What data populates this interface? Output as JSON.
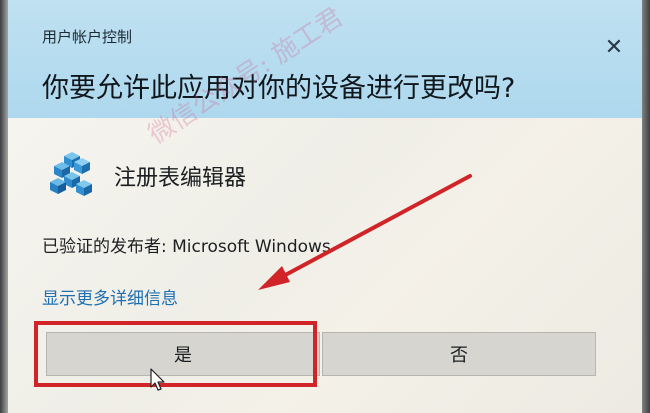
{
  "dialog": {
    "window_title": "用户帐户控制",
    "question": "你要允许此应用对你的设备进行更改吗?",
    "app_name": "注册表编辑器",
    "publisher_line": "已验证的发布者: Microsoft Windows",
    "details_link": "显示更多详细信息",
    "yes_button": "是",
    "no_button": "否",
    "close_glyph": "✕"
  },
  "overlay": {
    "watermark": "微信公众号: 施工君"
  },
  "colors": {
    "header_bg": "#aed8ee",
    "body_bg": "#f2f1ec",
    "link": "#1f6fb2",
    "annotation_red": "#d12428"
  },
  "icons": {
    "app_icon": "registry-editor-cubes-icon",
    "close": "close-icon",
    "pointer": "mouse-cursor-icon"
  }
}
